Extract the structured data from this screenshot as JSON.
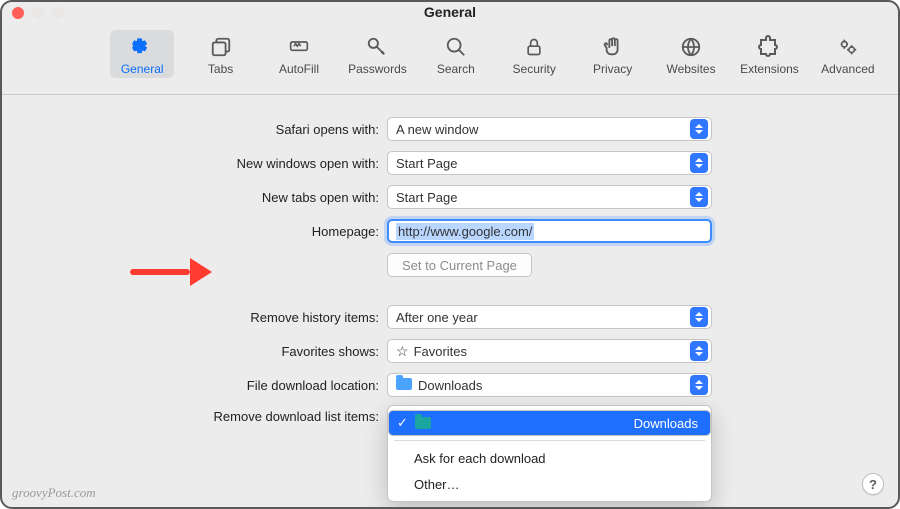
{
  "window": {
    "title": "General"
  },
  "toolbar": [
    {
      "name": "general",
      "label": "General"
    },
    {
      "name": "tabs",
      "label": "Tabs"
    },
    {
      "name": "autofill",
      "label": "AutoFill"
    },
    {
      "name": "passwords",
      "label": "Passwords"
    },
    {
      "name": "search",
      "label": "Search"
    },
    {
      "name": "security",
      "label": "Security"
    },
    {
      "name": "privacy",
      "label": "Privacy"
    },
    {
      "name": "websites",
      "label": "Websites"
    },
    {
      "name": "extensions",
      "label": "Extensions"
    },
    {
      "name": "advanced",
      "label": "Advanced"
    }
  ],
  "form": {
    "opens_with": {
      "label": "Safari opens with:",
      "value": "A new window"
    },
    "new_windows": {
      "label": "New windows open with:",
      "value": "Start Page"
    },
    "new_tabs": {
      "label": "New tabs open with:",
      "value": "Start Page"
    },
    "homepage": {
      "label": "Homepage:",
      "value": "http://www.google.com/"
    },
    "set_current": {
      "label": "Set to Current Page"
    },
    "remove_history": {
      "label": "Remove history items:",
      "value": "After one year"
    },
    "favorites": {
      "label": "Favorites shows:",
      "value": "Favorites"
    },
    "download_loc": {
      "label": "File download location:",
      "value": "Downloads"
    },
    "remove_dl": {
      "label": "Remove download list items:"
    }
  },
  "download_menu": {
    "selected": "Downloads",
    "ask": "Ask for each download",
    "other": "Other…"
  },
  "attribution": "groovyPost.com",
  "help": "?"
}
